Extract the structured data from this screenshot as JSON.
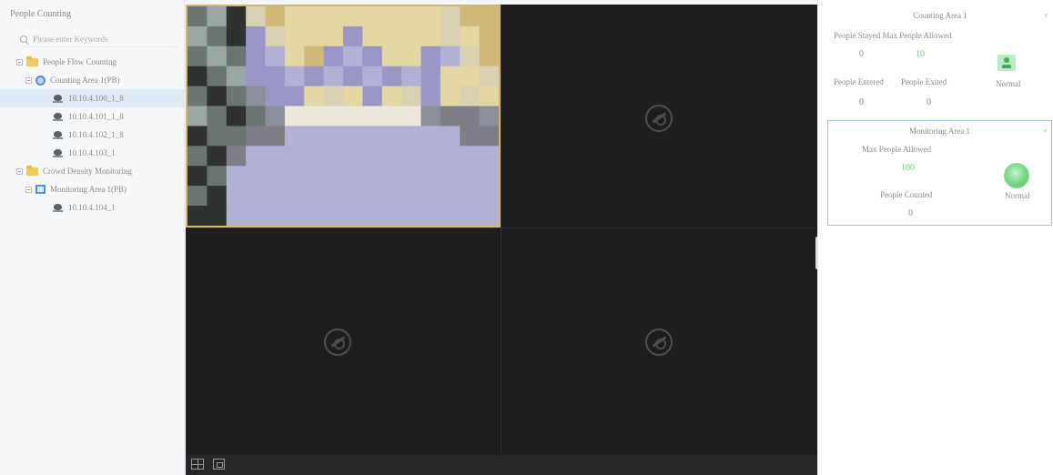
{
  "left_panel": {
    "title": "People Counting",
    "search_placeholder": "Please enter Keywords",
    "tree": [
      {
        "label": "People Flow Counting",
        "type": "folder",
        "indent": 0
      },
      {
        "label": "Counting Area 1(PB)",
        "type": "area",
        "indent": 1
      },
      {
        "label": "10.10.4.100_1_8",
        "type": "camera",
        "indent": 2,
        "selected": true
      },
      {
        "label": "10.10.4.101_1_8",
        "type": "camera",
        "indent": 2
      },
      {
        "label": "10.10.4.102_1_8",
        "type": "camera",
        "indent": 2
      },
      {
        "label": "10.10.4.103_1",
        "type": "camera",
        "indent": 2
      },
      {
        "label": "Crowd Density Monitoring",
        "type": "folder",
        "indent": 0
      },
      {
        "label": "Monitoring Area 1(PB)",
        "type": "monitor",
        "indent": 1
      },
      {
        "label": "10.10.4.104_1",
        "type": "camera",
        "indent": 2
      }
    ]
  },
  "card1": {
    "title": "Counting Area 1",
    "close": "×",
    "people_stayed_label": "People Stayed Max People Allowed",
    "people_stayed": "0",
    "max_allowed": "10",
    "people_entered_label": "People Entered",
    "people_exited_label": "People Exited",
    "people_entered": "0",
    "people_exited": "0",
    "status_label": "Normal"
  },
  "card2": {
    "title": "Monitoring Area 1",
    "close": "×",
    "max_allowed_label": "Max People Allowed",
    "max_allowed": "100",
    "people_counted_label": "People Counted",
    "people_counted": "0",
    "status_label": "Normal"
  },
  "colors": {
    "accent": "#4d8fd8",
    "selected_row": "#dfe9f7",
    "status_green": "#74c67f",
    "active_frame": "#d9b46d"
  }
}
